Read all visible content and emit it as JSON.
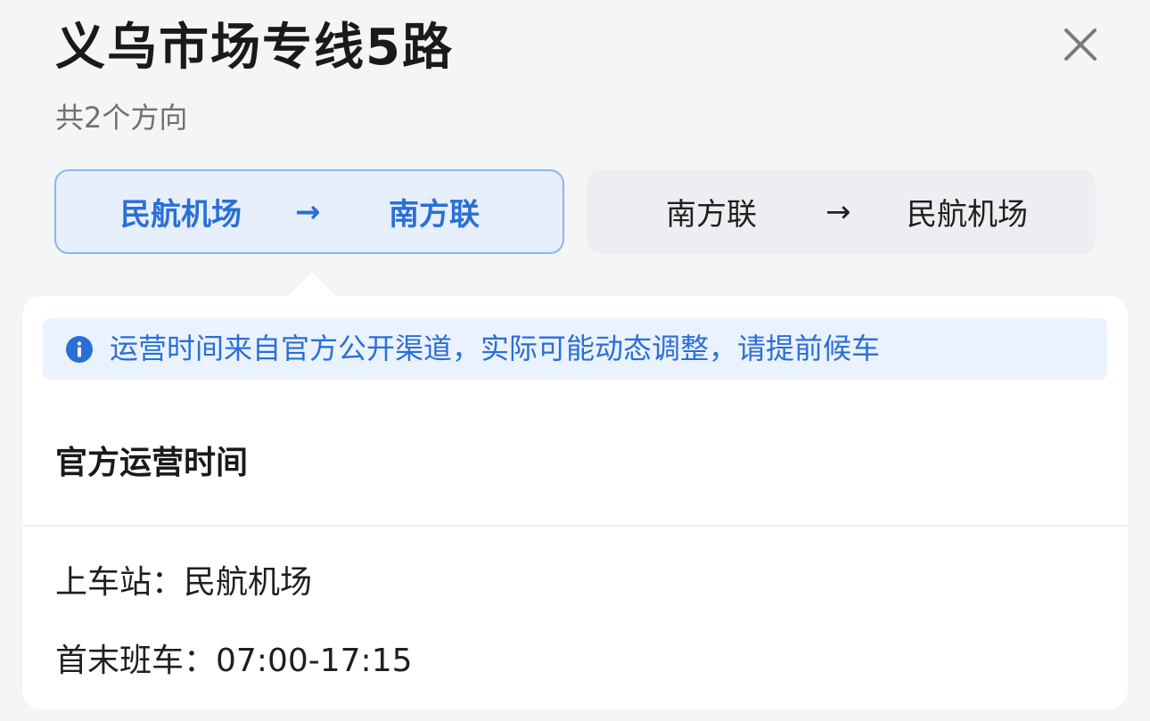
{
  "header": {
    "title": "义乌市场专线5路",
    "subtitle": "共2个方向"
  },
  "icons": {
    "close": "close-icon",
    "info": "info-icon",
    "arrow": "arrow-right-icon"
  },
  "directions": [
    {
      "from": "民航机场",
      "arrow": "→",
      "to": "南方联",
      "selected": true
    },
    {
      "from": "南方联",
      "arrow": "→",
      "to": "民航机场",
      "selected": false
    }
  ],
  "notice": {
    "text": "运营时间来自官方公开渠道，实际可能动态调整，请提前候车"
  },
  "schedule": {
    "section_title": "官方运营时间",
    "boarding_label": "上车站：",
    "boarding_station": "民航机场",
    "first_last_label": "首末班车：",
    "first_last_time": "07:00-17:15"
  },
  "colors": {
    "accent": "#2a6fd6",
    "accent_border": "#8ab7ee",
    "accent_bg": "#e6effb",
    "page_bg": "#f4f5f7",
    "notice_bg": "#eaf2fd"
  }
}
